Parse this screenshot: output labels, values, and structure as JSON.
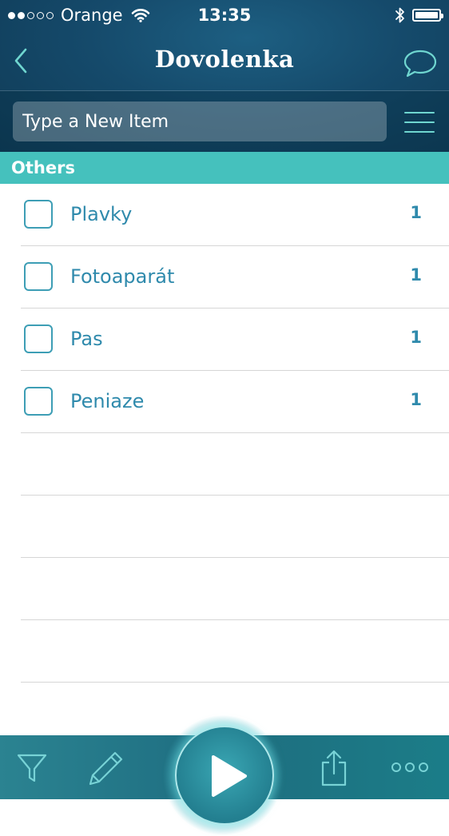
{
  "status_bar": {
    "carrier": "Orange",
    "time": "13:35",
    "signal_bars_filled": 2,
    "signal_bars_total": 5
  },
  "nav": {
    "title": "Dovolenka",
    "back_icon": "chevron-left-icon",
    "chat_icon": "speech-bubble-icon"
  },
  "new_item": {
    "placeholder": "Type a New Item"
  },
  "section": {
    "title": "Others"
  },
  "items": [
    {
      "name": "Plavky",
      "qty": "1",
      "checked": false
    },
    {
      "name": "Fotoaparát",
      "qty": "1",
      "checked": false
    },
    {
      "name": "Pas",
      "qty": "1",
      "checked": false
    },
    {
      "name": "Peniaze",
      "qty": "1",
      "checked": false
    }
  ],
  "toolbar": {
    "icons": [
      "filter-icon",
      "pencil-icon",
      "play-icon",
      "share-icon",
      "more-icon"
    ]
  },
  "colors": {
    "header_bg": "#154a6b",
    "section_bg": "#45c1bd",
    "item_text": "#2f8aac",
    "toolbar_bg": "#1f6f82"
  }
}
